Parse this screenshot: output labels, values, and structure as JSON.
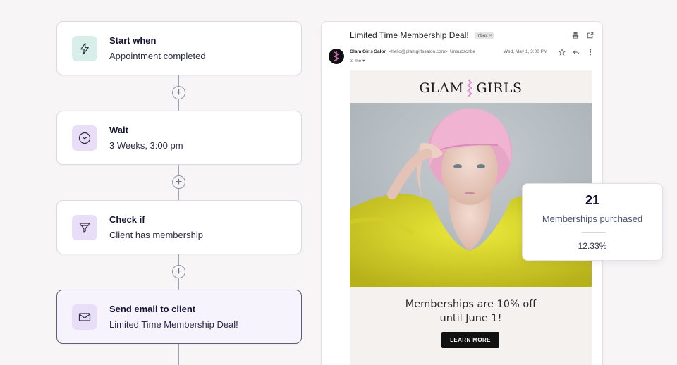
{
  "workflow": {
    "steps": [
      {
        "title": "Start when",
        "subtitle": "Appointment completed",
        "icon": "lightning-icon",
        "icon_bg": "#d7efe8"
      },
      {
        "title": "Wait",
        "subtitle": "3 Weeks, 3:00 pm",
        "icon": "clock-icon",
        "icon_bg": "#e9def8"
      },
      {
        "title": "Check if",
        "subtitle": "Client has membership",
        "icon": "funnel-icon",
        "icon_bg": "#e9def8"
      },
      {
        "title": "Send email to client",
        "subtitle": "Limited Time Membership Deal!",
        "icon": "envelope-icon",
        "icon_bg": "#e9def8"
      }
    ],
    "add_step_symbol": "+"
  },
  "email": {
    "subject": "Limited Time Membership Deal!",
    "badge": "Inbox",
    "badge_close": "×",
    "sender_name": "Glam Girls Salon",
    "sender_email": "<hello@glamgirlssalon.com>",
    "unsubscribe": "Unsubscribe",
    "date": "Wed, May 1, 3:00 PM",
    "to": "to me",
    "to_caret": "▾",
    "brand_left": "GLAM",
    "brand_right": "GIRLS",
    "promo_line1": "Memberships are 10% off",
    "promo_line2": "until June 1!",
    "cta": "LEARN MORE"
  },
  "stats": {
    "value": "21",
    "label": "Memberships purchased",
    "percent": "12.33%"
  },
  "colors": {
    "accent_purple": "#e9def8",
    "accent_green": "#d7efe8",
    "brand_pink": "#e07ac8"
  }
}
